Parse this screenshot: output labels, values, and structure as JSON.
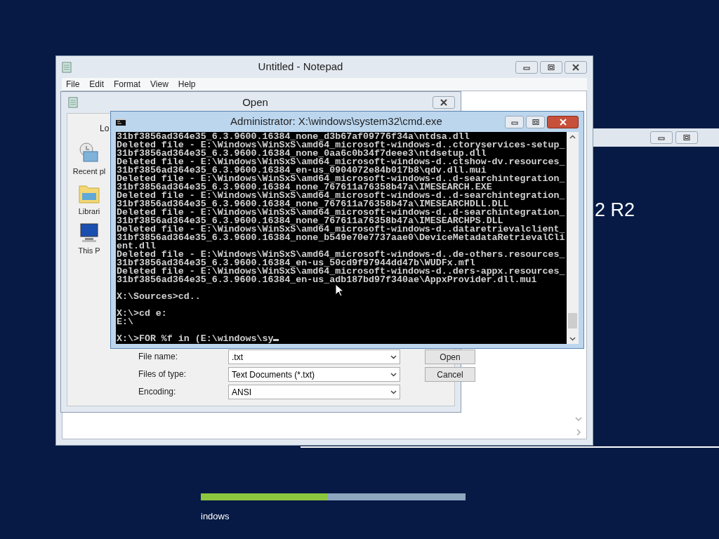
{
  "setup_window": {
    "heading": "2 R2"
  },
  "progress": {
    "level": 0.48,
    "caption": "indows"
  },
  "notepad": {
    "title": "Untitled - Notepad",
    "menu": [
      "File",
      "Edit",
      "Format",
      "View",
      "Help"
    ]
  },
  "open_dialog": {
    "title": "Open",
    "look_in_label": "Lo",
    "places": [
      {
        "kind": "recent",
        "label": "Recent pl"
      },
      {
        "kind": "libraries",
        "label": "Librari"
      },
      {
        "kind": "computer",
        "label": "This P"
      }
    ],
    "fields": [
      {
        "label": "File name:",
        "value": ".txt"
      },
      {
        "label": "Files of type:",
        "value": "Text Documents (*.txt)"
      },
      {
        "label": "Encoding:",
        "value": "ANSI"
      }
    ],
    "buttons": [
      "Open",
      "Cancel"
    ]
  },
  "cmd": {
    "title": "Administrator: X:\\windows\\system32\\cmd.exe",
    "cursor": true,
    "lines": [
      {
        "text": "31bf3856ad364e35_6.3.9600.16384_none_d3b67af09776f34a\\ntdsa.dll",
        "gap_before": false
      },
      {
        "text": "Deleted file - E:\\Windows\\WinSxS\\amd64_microsoft-windows-d..ctoryservices-setup_",
        "gap_before": false
      },
      {
        "text": "31bf3856ad364e35_6.3.9600.16384_none_0aa6c0b34f7deee3\\ntdsetup.dll",
        "gap_before": false
      },
      {
        "text": "Deleted file - E:\\Windows\\WinSxS\\amd64_microsoft-windows-d..ctshow-dv.resources_",
        "gap_before": false
      },
      {
        "text": "31bf3856ad364e35_6.3.9600.16384_en-us_0904072e84b017b8\\qdv.dll.mui",
        "gap_before": false
      },
      {
        "text": "Deleted file - E:\\Windows\\WinSxS\\amd64_microsoft-windows-d..d-searchintegration_",
        "gap_before": false
      },
      {
        "text": "31bf3856ad364e35_6.3.9600.16384_none_767611a76358b47a\\IMESEARCH.EXE",
        "gap_before": false
      },
      {
        "text": "Deleted file - E:\\Windows\\WinSxS\\amd64_microsoft-windows-d..d-searchintegration_",
        "gap_before": false
      },
      {
        "text": "31bf3856ad364e35_6.3.9600.16384_none_767611a76358b47a\\IMESEARCHDLL.DLL",
        "gap_before": false
      },
      {
        "text": "Deleted file - E:\\Windows\\WinSxS\\amd64_microsoft-windows-d..d-searchintegration_",
        "gap_before": false
      },
      {
        "text": "31bf3856ad364e35_6.3.9600.16384_none_767611a76358b47a\\IMESEARCHPS.DLL",
        "gap_before": false
      },
      {
        "text": "Deleted file - E:\\Windows\\WinSxS\\amd64_microsoft-windows-d..dataretrievalclient_",
        "gap_before": false
      },
      {
        "text": "31bf3856ad364e35_6.3.9600.16384_none_b549e70e7737aae0\\DeviceMetadataRetrievalCli",
        "gap_before": false
      },
      {
        "text": "ent.dll",
        "gap_before": false
      },
      {
        "text": "Deleted file - E:\\Windows\\WinSxS\\amd64_microsoft-windows-d..de-others.resources_",
        "gap_before": false
      },
      {
        "text": "31bf3856ad364e35_6.3.9600.16384_en-us_50cd9f97944dd47b\\WUDFx.mfl",
        "gap_before": false
      },
      {
        "text": "Deleted file - E:\\Windows\\WinSxS\\amd64_microsoft-windows-d..ders-appx.resources_",
        "gap_before": false
      },
      {
        "text": "31bf3856ad364e35_6.3.9600.16384_en-us_adb187bd97f340ae\\AppxProvider.dll.mui",
        "gap_before": false
      },
      {
        "text": "X:\\Sources>cd..",
        "gap_before": true
      },
      {
        "text": "X:\\>cd e:",
        "gap_before": true
      },
      {
        "text": "E:\\",
        "gap_before": false
      },
      {
        "text": "X:\\>FOR %f in (E:\\windows\\sy",
        "gap_before": true
      }
    ]
  }
}
